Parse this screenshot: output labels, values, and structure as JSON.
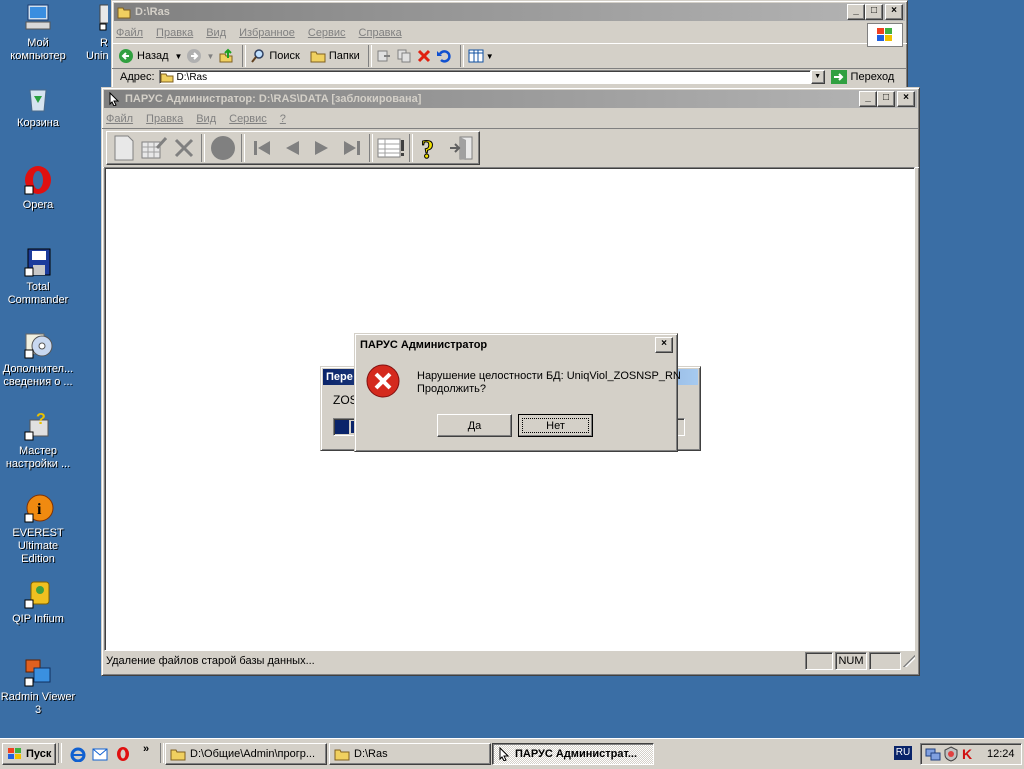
{
  "desktop": {
    "icons": [
      {
        "label": "Мой компьютер"
      },
      {
        "label": "Корзина"
      },
      {
        "label": "Opera"
      },
      {
        "label": "Total Commander"
      },
      {
        "label": "Дополнител... сведения о ..."
      },
      {
        "label": "Мастер настройки ..."
      },
      {
        "label": "EVEREST Ultimate Edition"
      },
      {
        "label": "QIP Infium"
      },
      {
        "label": "Radmin Viewer 3"
      }
    ],
    "partial_icon_label": "R Unin"
  },
  "explorer": {
    "title": "D:\\Ras",
    "menu": [
      "Файл",
      "Правка",
      "Вид",
      "Избранное",
      "Сервис",
      "Справка"
    ],
    "toolbar": {
      "back": "Назад",
      "search": "Поиск",
      "folders": "Папки"
    },
    "address_label": "Адрес:",
    "address_value": "D:\\Ras",
    "go_label": "Переход"
  },
  "parus": {
    "title": "ПАРУС Администратор: D:\\RAS\\DATA [заблокирована]",
    "menu": [
      "Файл",
      "Правка",
      "Вид",
      "Сервис",
      "?"
    ],
    "status_text": "Удаление файлов старой базы данных...",
    "status_num": "NUM"
  },
  "progress_dialog": {
    "title_partial": "Пере",
    "text_partial": "ZOS"
  },
  "error_dialog": {
    "title": "ПАРУС Администратор",
    "message_line1": "Нарушение целостности БД: UniqViol_ZOSNSP_RN",
    "message_line2": "Продолжить?",
    "yes_label": "Да",
    "no_label": "Нет"
  },
  "taskbar": {
    "start_label": "Пуск",
    "tasks": [
      {
        "label": "D:\\Общие\\Admin\\прогр..."
      },
      {
        "label": "D:\\Ras"
      },
      {
        "label": "ПАРУС Администрат..."
      }
    ],
    "lang": "RU",
    "clock": "12:24"
  },
  "colors": {
    "desktop": "#3a6ea5",
    "title_active": "#0a246a",
    "error_red": "#d42a1e"
  }
}
